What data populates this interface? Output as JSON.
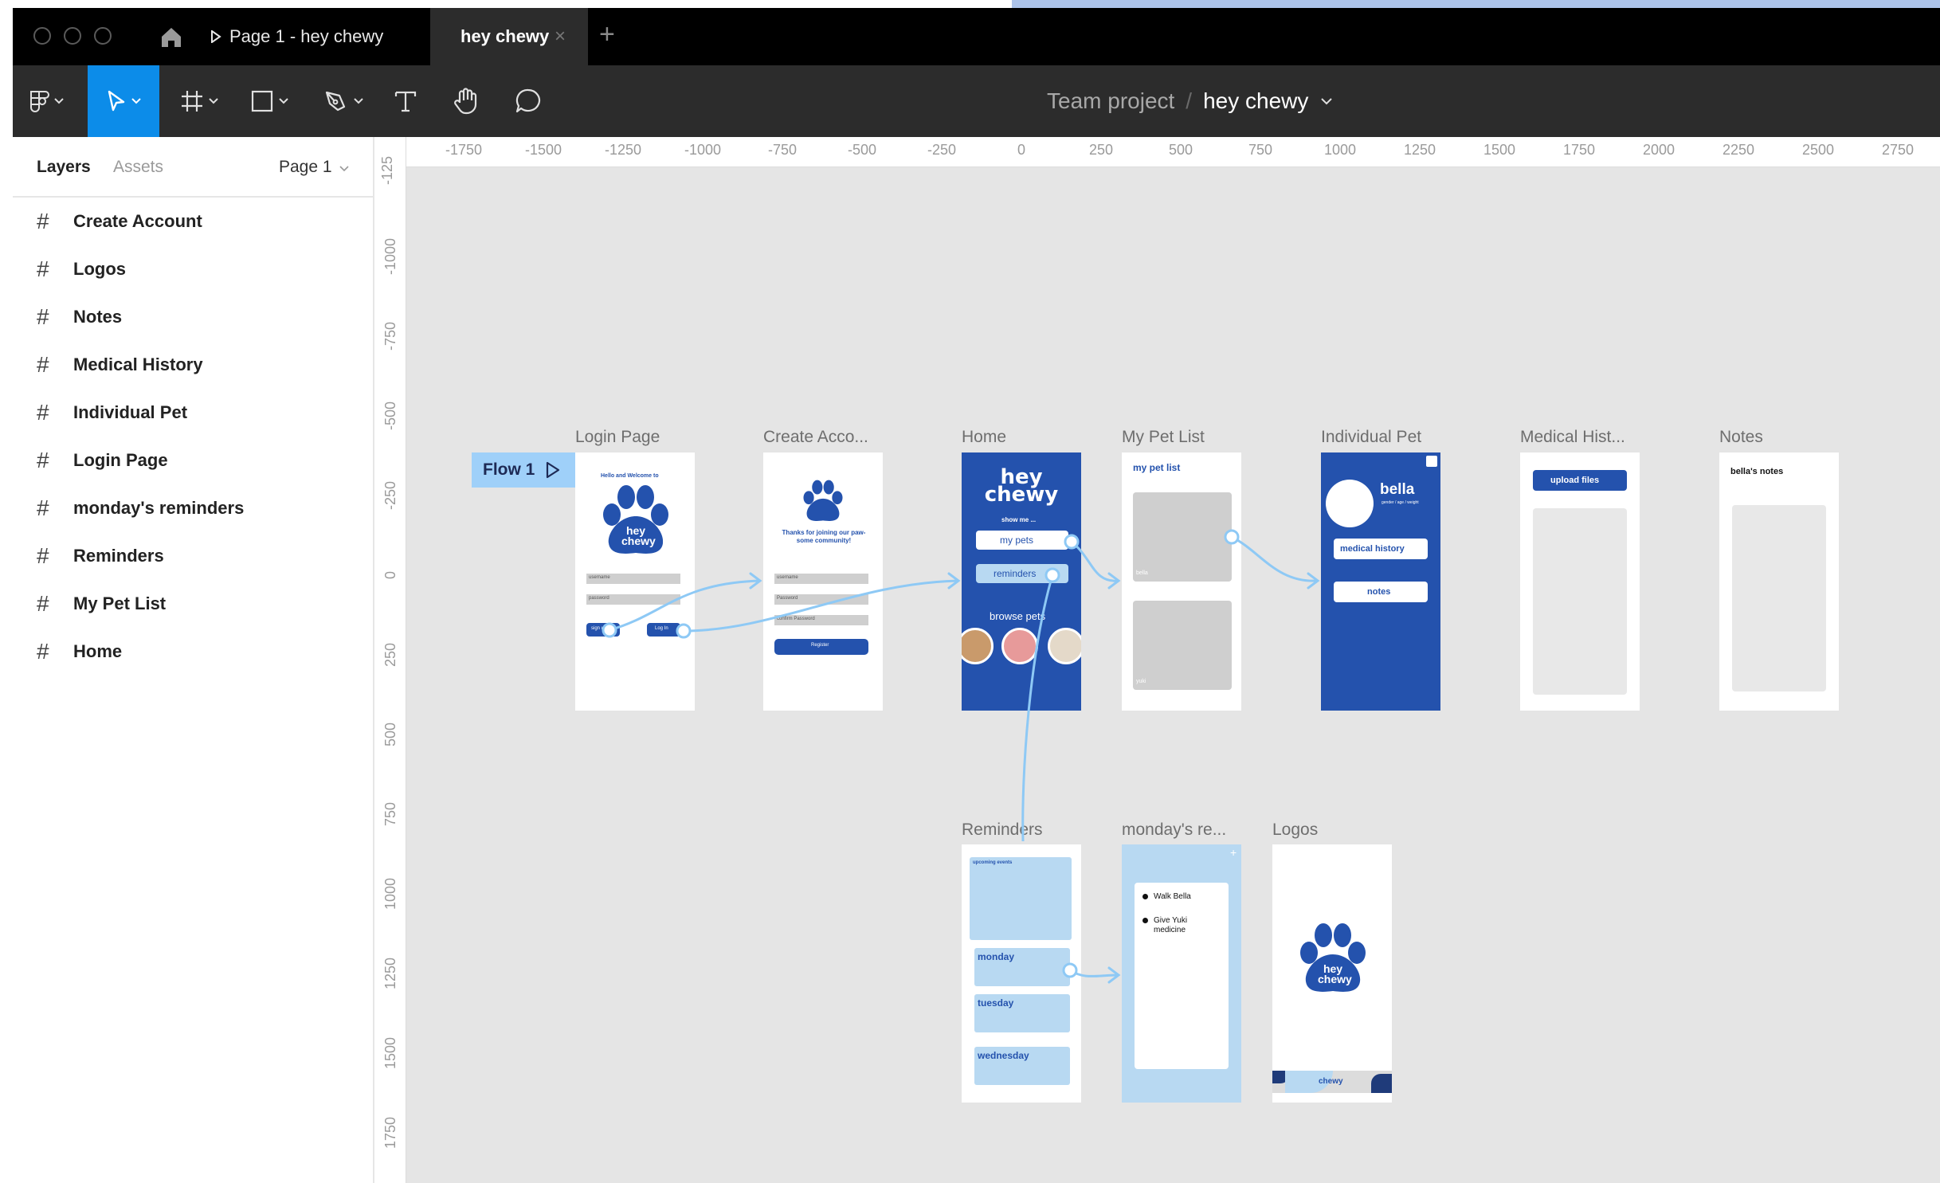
{
  "window": {
    "tabs": [
      {
        "label": "Page 1 - hey chewy"
      },
      {
        "label": "hey chewy"
      }
    ]
  },
  "toolbar": {
    "breadcrumb_project": "Team project",
    "breadcrumb_separator": "/",
    "breadcrumb_file": "hey chewy",
    "active_tool": "move",
    "tools": [
      "main-menu-icon",
      "move-icon",
      "frame-icon",
      "rectangle-icon",
      "pen-icon",
      "text-icon",
      "hand-icon",
      "comment-icon"
    ]
  },
  "sidebar": {
    "tab_layers": "Layers",
    "tab_assets": "Assets",
    "page_label": "Page 1",
    "layers": [
      {
        "label": "Create Account"
      },
      {
        "label": "Logos"
      },
      {
        "label": "Notes"
      },
      {
        "label": "Medical History"
      },
      {
        "label": "Individual Pet"
      },
      {
        "label": "Login Page"
      },
      {
        "label": "monday's reminders"
      },
      {
        "label": "Reminders"
      },
      {
        "label": "My Pet List"
      },
      {
        "label": "Home"
      }
    ]
  },
  "canvas": {
    "ruler_x": [
      "-1750",
      "-1500",
      "-1250",
      "-1000",
      "-750",
      "-500",
      "-250",
      "0",
      "250",
      "500",
      "750",
      "1000",
      "1250",
      "1500",
      "1750",
      "2000",
      "2250",
      "2500",
      "2750"
    ],
    "ruler_y": [
      "-125",
      "-1000",
      "-750",
      "-500",
      "-250",
      "0",
      "250",
      "500",
      "750",
      "1000",
      "1250",
      "1500",
      "1750"
    ],
    "flow_label": "Flow 1",
    "frames": {
      "login": {
        "label": "Login Page",
        "welcome": "Hello and Welcome to",
        "logo": "hey chewy",
        "field1": "username",
        "field2": "password",
        "btn1": "sign up",
        "btn2": "Log In"
      },
      "create": {
        "label": "Create Acco...",
        "thanks": "Thanks for joining our paw-some community!",
        "field1": "username",
        "field2": "Password",
        "field3": "confirm Password",
        "btn": "Register"
      },
      "home": {
        "label": "Home",
        "logo": "hey chewy",
        "show_me": "show me ...",
        "btn1": "my pets",
        "btn2": "reminders",
        "browse": "browse pets"
      },
      "mypets": {
        "label": "My Pet List",
        "title": "my pet list",
        "pet1": "bella",
        "pet2": "yuki"
      },
      "indiv": {
        "label": "Individual Pet",
        "name": "bella",
        "details": "gender / age / weight",
        "btn1": "medical history",
        "btn2": "notes"
      },
      "medical": {
        "label": "Medical Hist...",
        "btn": "upload files"
      },
      "notes": {
        "label": "Notes",
        "title": "bella's notes"
      },
      "reminders": {
        "label": "Reminders",
        "upcoming": "upcoming events",
        "day1": "monday",
        "day2": "tuesday",
        "day3": "wednesday"
      },
      "monday": {
        "label": "monday's re...",
        "item1": "Walk  Bella",
        "item2": "Give Yuki medicine"
      },
      "logos": {
        "label": "Logos",
        "logo": "hey chewy",
        "banner": "chewy"
      }
    }
  },
  "colors": {
    "brand_blue": "#2452ad",
    "light_blue": "#b8d9f2",
    "accent": "#0c8ce9",
    "connector": "#8ec9f5"
  }
}
